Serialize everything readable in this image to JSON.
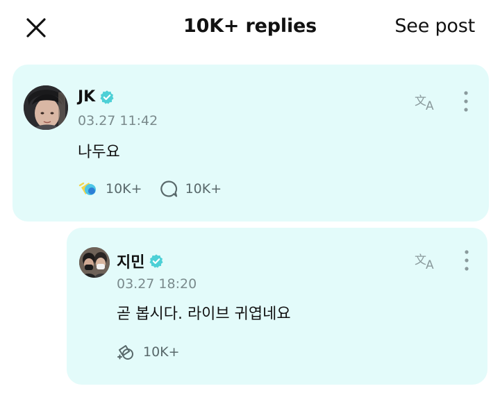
{
  "header": {
    "title": "10K+ replies",
    "see_post_label": "See post",
    "close_icon": "close-icon"
  },
  "colors": {
    "card_background": "#e3fbfa",
    "verified": "#4dd0d6",
    "muted_text": "#7a8a8c"
  },
  "comments": [
    {
      "author": "JK",
      "verified": true,
      "timestamp": "03.27 11:42",
      "text": "나두요",
      "reaction_icon": "reaction-emoji-icon",
      "reaction_count": "10K+",
      "reply_icon": "comment-bubble-icon",
      "reply_count": "10K+",
      "translate_icon": "translate-icon",
      "more_icon": "more-vertical-icon"
    },
    {
      "author": "지민",
      "verified": true,
      "timestamp": "03.27 18:20",
      "text": "곧 봅시다. 라이브 귀엽네요",
      "reaction_icon": "reaction-add-icon",
      "reaction_count": "10K+",
      "translate_icon": "translate-icon",
      "more_icon": "more-vertical-icon"
    }
  ]
}
